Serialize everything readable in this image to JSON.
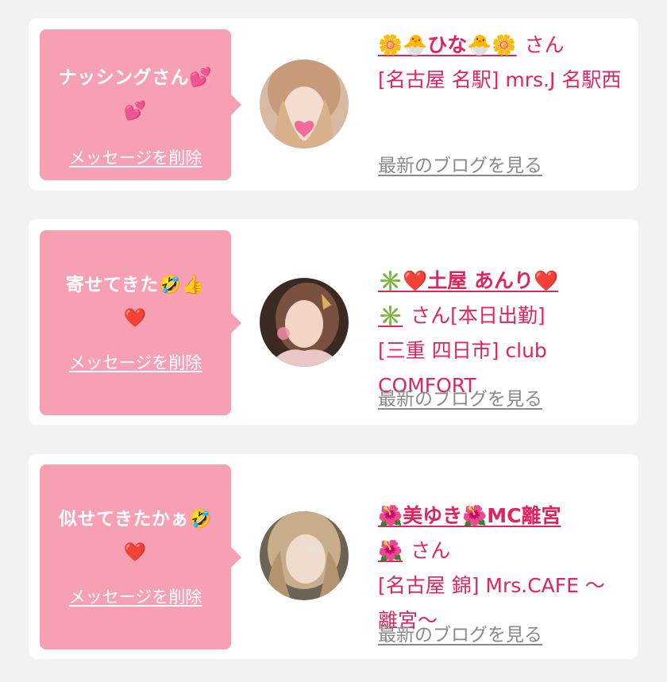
{
  "delete_label": "メッセージを削除",
  "blog_label": "最新のブログを見る",
  "san_suffix": "さん",
  "cards": [
    {
      "message": "ナッシングさん💕\n💕",
      "girl_name": "🌼🐣ひな🐣🌼",
      "girl_suffix": "さん",
      "shop": "[名古屋 名駅] mrs.J 名駅西"
    },
    {
      "message": "寄せてきた🤣👍\n❤️",
      "girl_name": "✳️❤️土屋 あんり❤️\n✳️",
      "girl_suffix": "さん[本日出勤]",
      "shop": "[三重 四日市] club COMFORT"
    },
    {
      "message": "似せてきたかぁ🤣\n❤️",
      "girl_name": "🌺美ゆき🌺MC離宮\n🌺",
      "girl_suffix": "さん",
      "shop": "[名古屋 錦] Mrs.CAFE 〜離宮〜"
    }
  ],
  "colors": {
    "bubble": "#f7a0b4",
    "accent": "#e0245e",
    "link_gray": "#8a8a8a"
  }
}
